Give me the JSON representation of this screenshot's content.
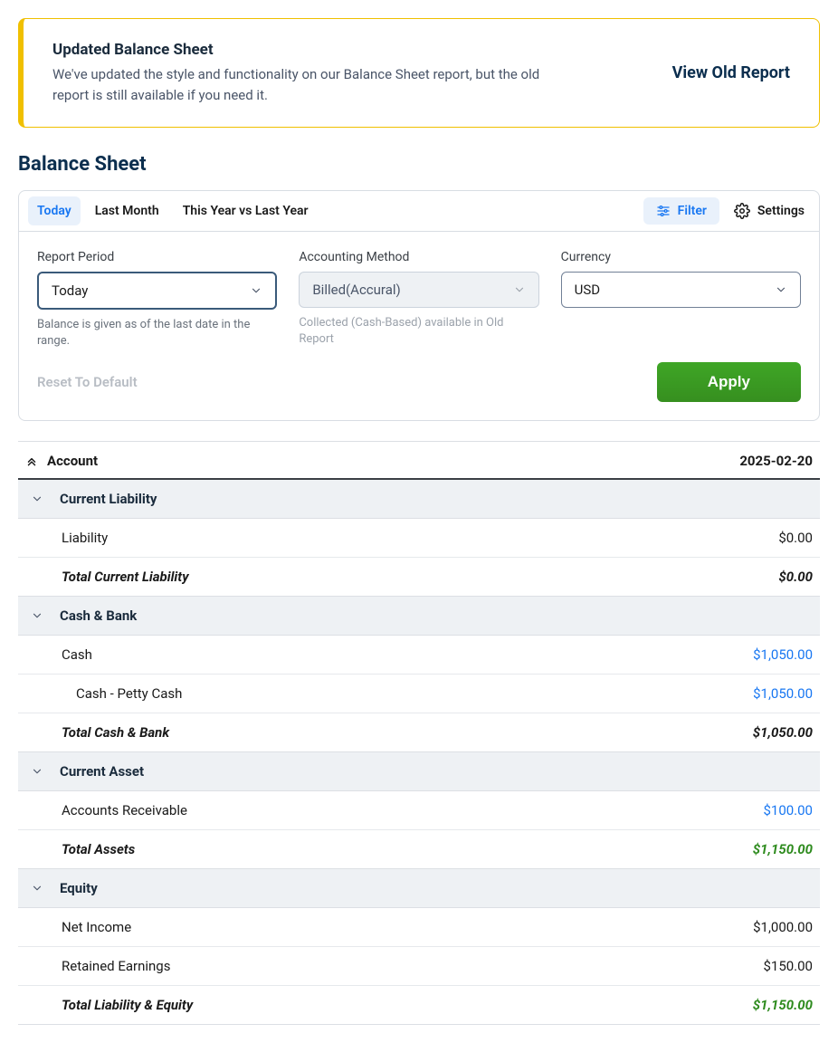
{
  "notice": {
    "title": "Updated Balance Sheet",
    "text": "We've updated the style and functionality on our Balance Sheet report, but the old report is still available if you need it.",
    "link": "View Old Report"
  },
  "page_title": "Balance Sheet",
  "tabs": {
    "active": "Today",
    "last_month": "Last Month",
    "compare": "This Year vs Last Year"
  },
  "topbar": {
    "filter": "Filter",
    "settings": "Settings"
  },
  "form": {
    "report_period_label": "Report Period",
    "report_period_value": "Today",
    "report_period_help": "Balance is given as of the last date in the range.",
    "accounting_method_label": "Accounting Method",
    "accounting_method_value": "Billed(Accural)",
    "accounting_method_help": "Collected (Cash-Based) available in Old Report",
    "currency_label": "Currency",
    "currency_value": "USD",
    "reset": "Reset To Default",
    "apply": "Apply"
  },
  "table": {
    "header_left": "Account",
    "header_right": "2025-02-20",
    "sections": [
      {
        "title": "Current Liability",
        "rows": [
          {
            "label": "Liability",
            "value": "$0.00",
            "link": false,
            "indent": 0
          }
        ],
        "total": {
          "label": "Total Current Liability",
          "value": "$0.00",
          "green": false
        }
      },
      {
        "title": "Cash & Bank",
        "rows": [
          {
            "label": "Cash",
            "value": "$1,050.00",
            "link": true,
            "indent": 0
          },
          {
            "label": "Cash - Petty Cash",
            "value": "$1,050.00",
            "link": true,
            "indent": 1
          }
        ],
        "total": {
          "label": "Total Cash & Bank",
          "value": "$1,050.00",
          "green": false
        }
      },
      {
        "title": "Current Asset",
        "rows": [
          {
            "label": "Accounts Receivable",
            "value": "$100.00",
            "link": true,
            "indent": 0
          }
        ],
        "total": {
          "label": "Total Assets",
          "value": "$1,150.00",
          "green": true
        }
      },
      {
        "title": "Equity",
        "rows": [
          {
            "label": "Net Income",
            "value": "$1,000.00",
            "link": false,
            "indent": 0
          },
          {
            "label": "Retained Earnings",
            "value": "$150.00",
            "link": false,
            "indent": 0
          }
        ],
        "total": {
          "label": "Total Liability & Equity",
          "value": "$1,150.00",
          "green": true
        }
      }
    ]
  }
}
